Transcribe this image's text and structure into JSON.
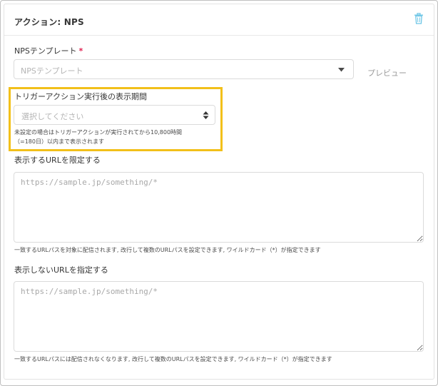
{
  "header": {
    "title": "アクション: NPS",
    "delete_icon": "trash-icon"
  },
  "nps_template": {
    "label": "NPSテンプレート",
    "required_mark": "*",
    "placeholder": "NPSテンプレート",
    "preview_label": "プレビュー"
  },
  "display_period": {
    "label": "トリガーアクション実行後の表示期間",
    "placeholder": "選択してください",
    "help_line1": "未設定の場合はトリガーアクションが実行されてから10,800時間",
    "help_line2": "（=180日）以内まで表示されます"
  },
  "limit_urls": {
    "label": "表示するURLを限定する",
    "placeholder": "https://sample.jp/something/*",
    "help": "一致するURLパスを対象に配信されます, 改行して複数のURLパスを設定できます, ワイルドカード（*）が指定できます"
  },
  "exclude_urls": {
    "label": "表示しないURLを指定する",
    "placeholder": "https://sample.jp/something/*",
    "help": "一致するURLパスには配信されなくなります, 改行して複数のURLパスを設定できます, ワイルドカード（*）が指定できます"
  },
  "colors": {
    "highlight": "#f2c01a",
    "trash_icon": "#6ec6e6",
    "required": "#e02050"
  }
}
